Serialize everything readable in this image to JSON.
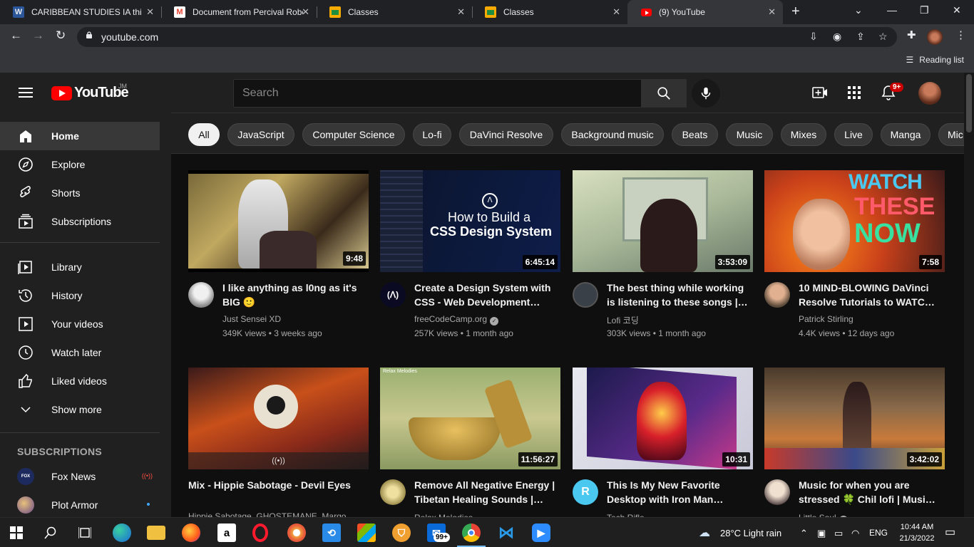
{
  "browser": {
    "tabs": [
      {
        "title": "CARIBBEAN STUDIES IA third",
        "icon": "word-icon",
        "color": "#2b579a"
      },
      {
        "title": "Document from Percival Robe",
        "icon": "gmail-icon",
        "color": "#ea4335"
      },
      {
        "title": "Classes",
        "icon": "classroom-icon",
        "color": "#f9ab00"
      },
      {
        "title": "Classes",
        "icon": "classroom-icon",
        "color": "#f9ab00"
      },
      {
        "title": "(9) YouTube",
        "icon": "youtube-icon",
        "color": "#ff0000"
      }
    ],
    "url": "youtube.com",
    "reading_list": "Reading list"
  },
  "youtube": {
    "logo_text": "YouTube",
    "country_code": "JM",
    "search_placeholder": "Search",
    "notification_count": "9+",
    "sidebar": {
      "main": [
        {
          "label": "Home",
          "icon": "home-icon",
          "active": true
        },
        {
          "label": "Explore",
          "icon": "compass-icon"
        },
        {
          "label": "Shorts",
          "icon": "shorts-icon"
        },
        {
          "label": "Subscriptions",
          "icon": "subscriptions-icon"
        }
      ],
      "library": [
        {
          "label": "Library",
          "icon": "library-icon"
        },
        {
          "label": "History",
          "icon": "history-icon"
        },
        {
          "label": "Your videos",
          "icon": "your-videos-icon"
        },
        {
          "label": "Watch later",
          "icon": "clock-icon"
        },
        {
          "label": "Liked videos",
          "icon": "thumbs-up-icon"
        },
        {
          "label": "Show more",
          "icon": "chevron-down-icon"
        }
      ],
      "subscriptions_heading": "SUBSCRIPTIONS",
      "subscriptions": [
        {
          "label": "Fox News",
          "status": "live"
        },
        {
          "label": "Plot Armor",
          "status": "new"
        }
      ]
    },
    "chips": [
      "All",
      "JavaScript",
      "Computer Science",
      "Lo-fi",
      "DaVinci Resolve",
      "Background music",
      "Beats",
      "Music",
      "Mixes",
      "Live",
      "Manga",
      "Mic"
    ],
    "videos": [
      {
        "title": "I like anything as l0ng as it's BIG 🙂",
        "channel": "Just Sensei XD",
        "stats": "349K views • 3 weeks ago",
        "duration": "9:48",
        "verified": false
      },
      {
        "title": "Create a Design System with CSS - Web Development…",
        "channel": "freeCodeCamp.org",
        "stats": "257K views • 1 month ago",
        "duration": "6:45:14",
        "verified": true,
        "thumb_text_1": "How to Build a",
        "thumb_text_2": "CSS Design System"
      },
      {
        "title": "The best thing while working is listening to these songs |…",
        "channel": "Lofi 코딩",
        "stats": "303K views • 1 month ago",
        "duration": "3:53:09",
        "verified": false
      },
      {
        "title": "10 MIND-BLOWING DaVinci Resolve Tutorials to WATC…",
        "channel": "Patrick Stirling",
        "stats": "4.4K views • 12 days ago",
        "duration": "7:58",
        "verified": false,
        "thumb_text_1": "WATCH",
        "thumb_text_2": "THESE",
        "thumb_text_3": "NOW"
      },
      {
        "title": "Mix - Hippie Sabotage - Devil Eyes",
        "channel": "Hippie Sabotage, GHOSTEMANE, Margo, and more",
        "stats": "",
        "duration": "",
        "verified": false
      },
      {
        "title": "Remove All Negative Energy | Tibetan Healing Sounds |…",
        "channel": "Relax Melodies",
        "stats": "",
        "duration": "11:56:27",
        "verified": false,
        "thumb_text_1": "Relax Melodies"
      },
      {
        "title": "This Is My New Favorite Desktop with Iron Man…",
        "channel": "Tech Rifle",
        "stats": "",
        "duration": "10:31",
        "verified": false
      },
      {
        "title": "Music for when you are stressed 🍀 Chil lofi | Musi…",
        "channel": "Little Soul",
        "stats": "",
        "duration": "3:42:02",
        "verified": true
      }
    ]
  },
  "taskbar": {
    "weather": "28°C  Light rain",
    "language": "ENG",
    "time": "10:44 AM",
    "date": "21/3/2022",
    "mail_badge": "99+"
  }
}
